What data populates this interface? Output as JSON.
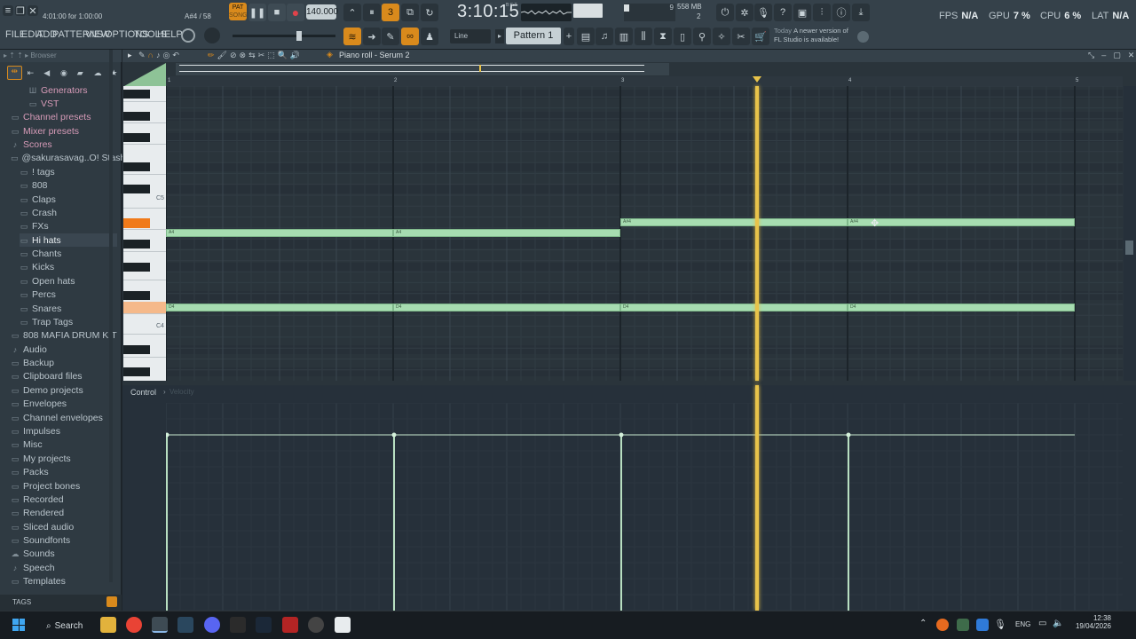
{
  "hint": {
    "line1": "",
    "line2": "4:01:00 for 1:00:00",
    "note": "A#4 / 58"
  },
  "transport": {
    "pat": "PAT",
    "song": "SONG",
    "tempo": "140.000",
    "time": "3:10:15",
    "time_label": "B:S:T"
  },
  "meters": {
    "mem": "558 MB",
    "voices": "9",
    "cpu_cores": "2"
  },
  "stats": {
    "fps_label": "FPS",
    "fps": "N/A",
    "gpu_label": "GPU",
    "gpu": "7 %",
    "cpu_label": "CPU",
    "cpu": "6 %",
    "lat_label": "LAT",
    "lat": "N/A"
  },
  "menu": [
    "FILE",
    "EDIT",
    "ADD",
    "PATTERNS",
    "VIEW",
    "OPTIONS",
    "TOOLS",
    "HELP"
  ],
  "pattern": {
    "name": "Pattern 1",
    "snap": "Line"
  },
  "news": {
    "day": "Today",
    "text1": "A newer version of",
    "text2": "FL Studio is available!"
  },
  "browser": {
    "title": "Browser",
    "tags": "TAGS",
    "items": [
      "Generators",
      "VST",
      "Channel presets",
      "Mixer presets",
      "Scores",
      "@sakurasavag..O! Stash Kit",
      "! tags",
      "808",
      "Claps",
      "Crash",
      "FXs",
      "Hi hats",
      "Chants",
      "Kicks",
      "Open hats",
      "Percs",
      "Snares",
      "Trap Tags",
      "808 MAFIA DRUM KIT",
      "Audio",
      "Backup",
      "Clipboard files",
      "Demo projects",
      "Envelopes",
      "Channel envelopes",
      "Impulses",
      "Misc",
      "My projects",
      "Packs",
      "Project bones",
      "Recorded",
      "Rendered",
      "Sliced audio",
      "Soundfonts",
      "Sounds",
      "Speech",
      "Templates"
    ]
  },
  "pianoroll": {
    "title": "Piano roll - Serum 2",
    "bars": [
      "1",
      "2",
      "3",
      "4",
      "5"
    ],
    "c5": "C5",
    "c4": "C4",
    "notes": [
      {
        "label": "A4"
      },
      {
        "label": "A4"
      },
      {
        "label": "A#4"
      },
      {
        "label": "A#4"
      },
      {
        "label": "D4"
      },
      {
        "label": "D4"
      },
      {
        "label": "D4"
      },
      {
        "label": "D4"
      }
    ]
  },
  "control": {
    "label": "Control",
    "param": "Velocity"
  },
  "taskbar": {
    "search": "Search",
    "lang": "ENG",
    "time": "12:38",
    "date": "19/04/2026"
  },
  "colors": {
    "note": "#a7ddb1",
    "playhead": "#e8c34a",
    "accent": "#f0a030",
    "bg": "#2a343b"
  }
}
